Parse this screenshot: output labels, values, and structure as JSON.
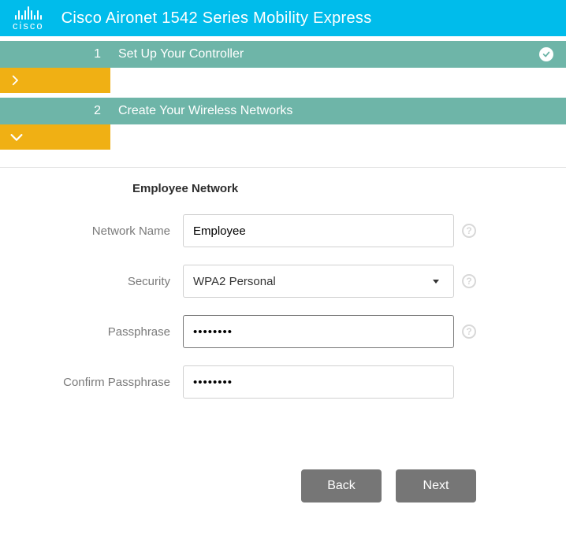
{
  "header": {
    "brand": "cisco",
    "title": "Cisco Aironet 1542 Series Mobility Express"
  },
  "steps": [
    {
      "number": "1",
      "title": "Set Up Your Controller",
      "complete": true
    },
    {
      "number": "2",
      "title": "Create Your Wireless Networks",
      "complete": false
    }
  ],
  "form": {
    "section_title": "Employee Network",
    "labels": {
      "network_name": "Network Name",
      "security": "Security",
      "passphrase": "Passphrase",
      "confirm_passphrase": "Confirm Passphrase"
    },
    "values": {
      "network_name": "Employee",
      "security": "WPA2 Personal",
      "passphrase": "••••••••",
      "confirm_passphrase": "••••••••"
    }
  },
  "buttons": {
    "back": "Back",
    "next": "Next"
  }
}
